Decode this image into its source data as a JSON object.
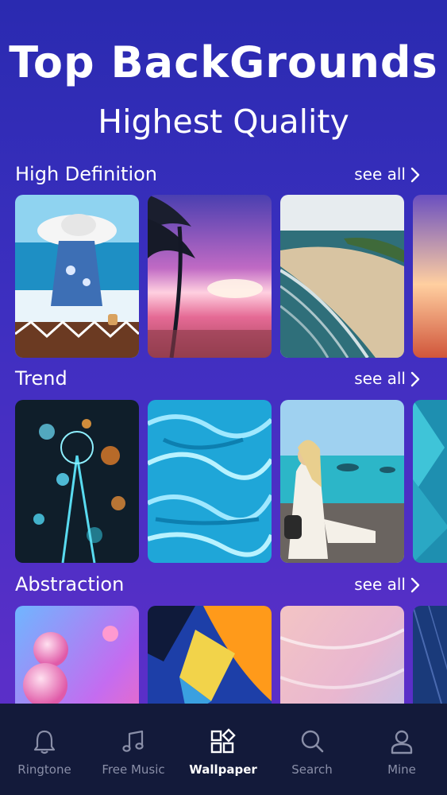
{
  "hero": {
    "title": "Top BackGrounds",
    "subtitle": "Highest Quality"
  },
  "sections": [
    {
      "title": "High Definition",
      "see_all": "see all",
      "thumbnails": [
        "woman-in-hat-at-beach",
        "palm-tree-sunset",
        "coastline-aerial",
        "sunset-partial"
      ]
    },
    {
      "title": "Trend",
      "see_all": "see all",
      "thumbnails": [
        "bokeh-lights",
        "blue-water-ripples",
        "woman-by-sea",
        "teal-feathers"
      ]
    },
    {
      "title": "Abstraction",
      "see_all": "see all",
      "thumbnails": [
        "pink-bubbles",
        "blue-orange-abstract",
        "pastel-waves",
        "starry-blue"
      ]
    }
  ],
  "tabbar": {
    "items": [
      {
        "label": "Ringtone",
        "icon": "bell-icon"
      },
      {
        "label": "Free Music",
        "icon": "music-note-icon"
      },
      {
        "label": "Wallpaper",
        "icon": "wallpaper-grid-icon",
        "active": true
      },
      {
        "label": "Search",
        "icon": "search-icon"
      },
      {
        "label": "Mine",
        "icon": "user-icon"
      }
    ]
  },
  "colors": {
    "background_top": "#2a2ab0",
    "background_bottom": "#5d2fc6",
    "tabbar_bg": "#131a3a",
    "tab_inactive": "#8a8fa8",
    "tab_active": "#ffffff"
  }
}
